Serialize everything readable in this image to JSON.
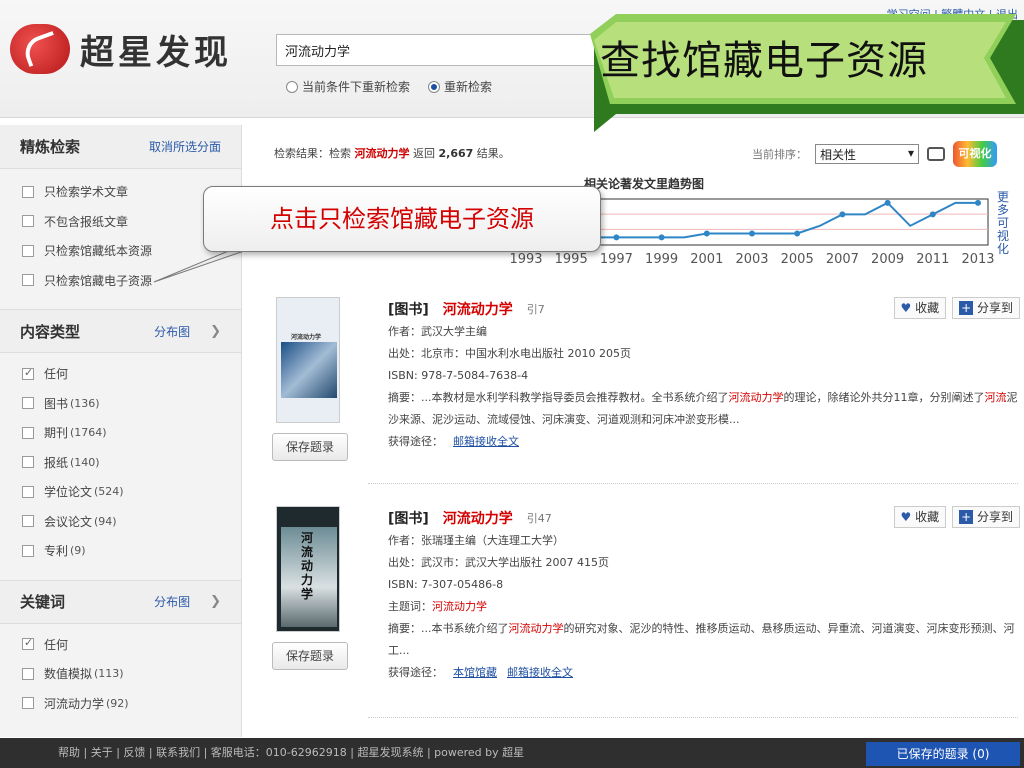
{
  "header": {
    "logo_text": "超星发现",
    "search_value": "河流动力学",
    "radio_options": [
      "当前条件下重新检索",
      "重新检索"
    ],
    "top_links": "学习空间 | 繁體中文 | 退出",
    "banner_text": "查找馆藏电子资源"
  },
  "callout": {
    "text": "点击只检索馆藏电子资源"
  },
  "sidebar": {
    "refine": {
      "title": "精炼检索",
      "link": "取消所选分面",
      "options": [
        "只检索学术文章",
        "不包含报纸文章",
        "只检索馆藏纸本资源",
        "只检索馆藏电子资源"
      ]
    },
    "content_type": {
      "title": "内容类型",
      "link": "分布图",
      "options": [
        {
          "label": "任何",
          "count": ""
        },
        {
          "label": "图书",
          "count": "(136)"
        },
        {
          "label": "期刊",
          "count": "(1764)"
        },
        {
          "label": "报纸",
          "count": "(140)"
        },
        {
          "label": "学位论文",
          "count": "(524)"
        },
        {
          "label": "会议论文",
          "count": "(94)"
        },
        {
          "label": "专利",
          "count": "(9)"
        }
      ]
    },
    "keywords": {
      "title": "关键词",
      "link": "分布图",
      "options": [
        {
          "label": "任何",
          "count": ""
        },
        {
          "label": "数值模拟",
          "count": "(113)"
        },
        {
          "label": "河流动力学",
          "count": "(92)"
        }
      ]
    }
  },
  "results_bar": {
    "prefix": "检索结果：检索",
    "term": "河流动力学",
    "mid": "返回",
    "count": "2,667",
    "suffix": "结果。"
  },
  "sort": {
    "label": "当前排序：",
    "value": "相关性",
    "vis_label": "可视化"
  },
  "chart_data": {
    "type": "line",
    "title": "相关论著发文里趋势图",
    "x": [
      1993,
      1994,
      1995,
      1996,
      1997,
      1998,
      1999,
      2000,
      2001,
      2002,
      2003,
      2004,
      2005,
      2006,
      2007,
      2008,
      2009,
      2010,
      2011,
      2012,
      2013
    ],
    "values": [
      2,
      2,
      2,
      2,
      2,
      2,
      2,
      2,
      3,
      3,
      3,
      3,
      3,
      5,
      8,
      8,
      11,
      5,
      8,
      11,
      11
    ],
    "tick_labels": [
      "1993",
      "1995",
      "1997",
      "1999",
      "2001",
      "2003",
      "2005",
      "2007",
      "2009",
      "2011",
      "2013"
    ],
    "more_link": "更多可视化"
  },
  "results": [
    {
      "type": "[图书]",
      "title": "河流动力学",
      "cite": "引7",
      "author": "作者：武汉大学主编",
      "source": "出处：北京市：中国水利水电出版社 2010 205页",
      "isbn": "ISBN: 978-7-5084-7638-4",
      "abstract_a": "摘要：...本教材是水利学科教学指导委员会推荐教材。全书系统介绍了",
      "abstract_hl": "河流动力学",
      "abstract_b": "的理论，除绪论外共分11章，分别阐述了",
      "abstract_hl2": "河流",
      "abstract_c": "泥沙来源、泥沙运动、流域侵蚀、河床演变、河道观测和河床冲淤变形模...",
      "access_label": "获得途径：",
      "links": [
        "邮箱接收全文"
      ],
      "save": "保存题录",
      "cover_title": "河流动力学"
    },
    {
      "type": "[图书]",
      "title": "河流动力学",
      "cite": "引47",
      "author": "作者：张瑞瑾主编（大连理工大学）",
      "source": "出处：武汉市：武汉大学出版社 2007 415页",
      "isbn": "ISBN: 7-307-05486-8",
      "subject_label": "主题词：",
      "subject": "河流动力学",
      "abstract_a": "摘要：...本书系统介绍了",
      "abstract_hl": "河流动力学",
      "abstract_b": "的研究对象、泥沙的特性、推移质运动、悬移质运动、异重流、河道演变、河床变形预测、河工...",
      "access_label": "获得途径：",
      "links": [
        "本馆馆藏",
        "邮箱接收全文"
      ],
      "save": "保存题录",
      "cover_title": "河流动力学"
    }
  ],
  "actions": {
    "collect": "收藏",
    "share": "分享到"
  },
  "footer": {
    "text": "帮助 | 关于 | 反馈 | 联系我们 | 客服电话：010-62962918 | 超星发现系统 | powered by 超星",
    "saved": "已保存的题录 (0)"
  }
}
